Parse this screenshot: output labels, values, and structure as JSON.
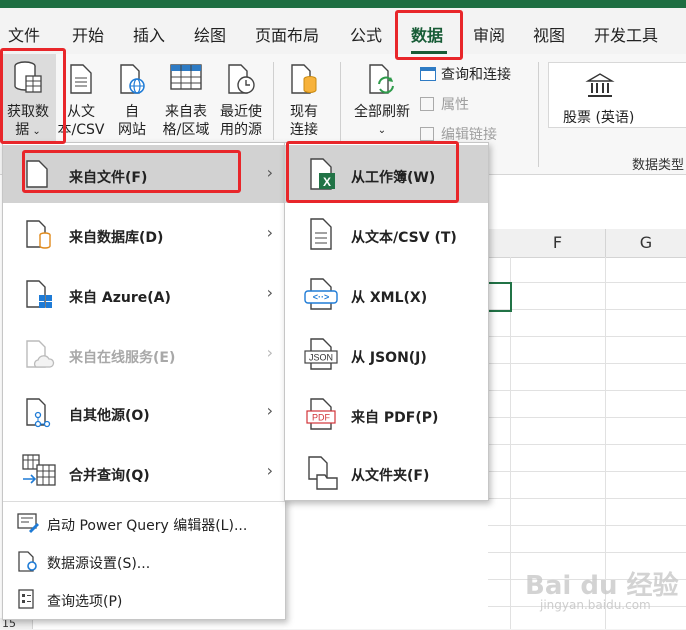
{
  "tabs": [
    "文件",
    "开始",
    "插入",
    "绘图",
    "页面布局",
    "公式",
    "数据",
    "审阅",
    "视图",
    "开发工具"
  ],
  "active_tab": "数据",
  "ribbon": {
    "get_data": "获取数",
    "get_data2": "据",
    "from_text": "从文",
    "from_text2": "本/CSV",
    "from_web": "自",
    "from_web2": "网站",
    "from_table": "来自表",
    "from_table2": "格/区域",
    "recent": "最近使",
    "recent2": "用的源",
    "existing": "现有",
    "existing2": "连接",
    "refresh_all": "全部刷新",
    "queries_conn": "查询和连接",
    "properties": "属性",
    "edit_links": "编辑链接",
    "stocks": "股票 (英语)",
    "data_types_label": "数据类型"
  },
  "columns": [
    "F",
    "G"
  ],
  "row_partial": "15",
  "menu1": {
    "items": [
      {
        "label": "来自文件(F)",
        "has_arrow": true,
        "enabled": true
      },
      {
        "label": "来自数据库(D)",
        "has_arrow": true,
        "enabled": true
      },
      {
        "label": "来自 Azure(A)",
        "has_arrow": true,
        "enabled": true
      },
      {
        "label": "来自在线服务(E)",
        "has_arrow": true,
        "enabled": false
      },
      {
        "label": "自其他源(O)",
        "has_arrow": true,
        "enabled": true
      },
      {
        "label": "合并查询(Q)",
        "has_arrow": true,
        "enabled": true
      },
      {
        "label": "启动 Power Query 编辑器(L)...",
        "has_arrow": false,
        "enabled": true
      },
      {
        "label": "数据源设置(S)...",
        "has_arrow": false,
        "enabled": true
      },
      {
        "label": "查询选项(P)",
        "has_arrow": false,
        "enabled": true
      }
    ]
  },
  "menu2": {
    "items": [
      {
        "label": "从工作簿(W)",
        "icon": "excel-workbook-icon"
      },
      {
        "label": "从文本/CSV (T)",
        "icon": "text-file-icon"
      },
      {
        "label": "从 XML(X)",
        "icon": "xml-file-icon"
      },
      {
        "label": "从 JSON(J)",
        "icon": "json-file-icon"
      },
      {
        "label": "来自 PDF(P)",
        "icon": "pdf-file-icon"
      },
      {
        "label": "从文件夹(F)",
        "icon": "folder-icon"
      }
    ]
  },
  "icon_text": {
    "xml": "<··>",
    "json": "JSON",
    "pdf": "PDF",
    "excel": "X"
  },
  "watermark": "Bai du 经验",
  "watermark_url": "jingyan.baidu.com",
  "colors": {
    "excel_green": "#217346",
    "highlight_red": "#e8262a",
    "menu_highlight": "#d2d2d2"
  }
}
